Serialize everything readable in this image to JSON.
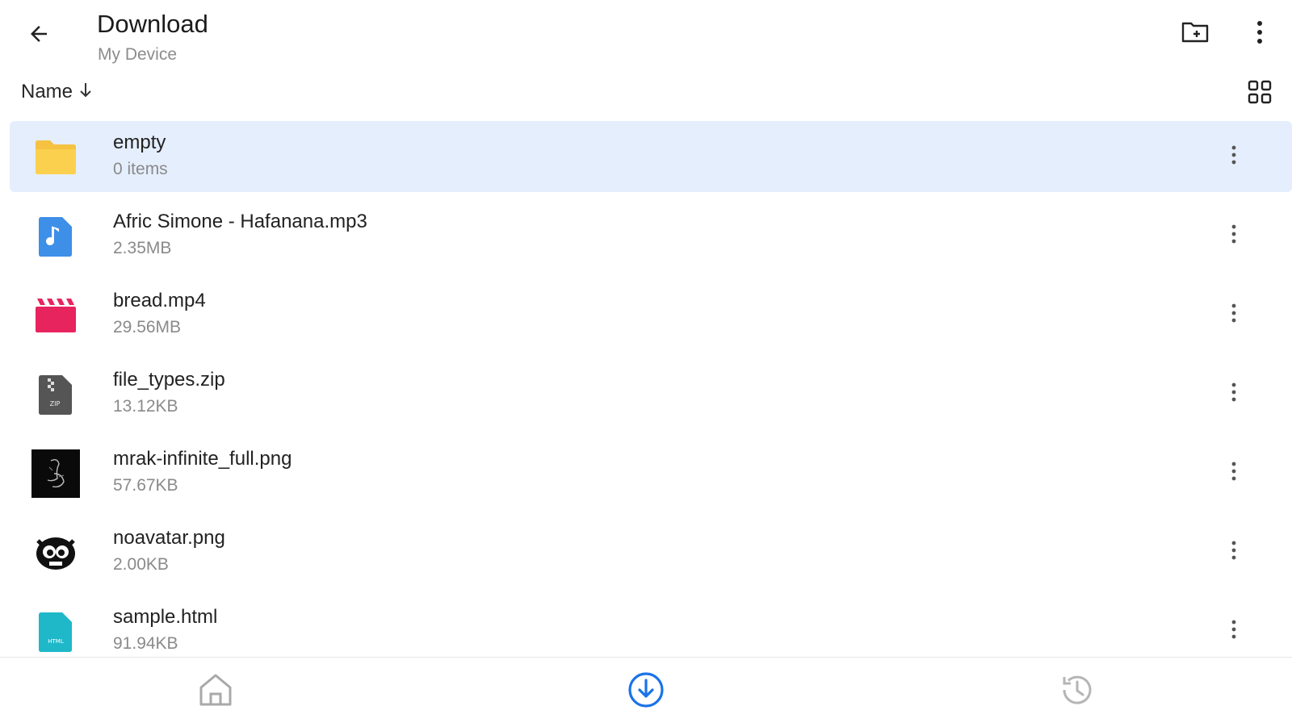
{
  "header": {
    "title": "Download",
    "subtitle": "My Device",
    "back_icon": "arrow-back-icon",
    "new_folder_icon": "create-new-folder-icon",
    "overflow_icon": "more-vert-icon"
  },
  "sort": {
    "label": "Name",
    "direction_icon": "arrow-down-icon",
    "view_toggle_icon": "grid-view-icon"
  },
  "files": [
    {
      "name": "empty",
      "meta": "0 items",
      "icon": "folder-icon",
      "selected": true
    },
    {
      "name": "Afric Simone - Hafanana.mp3",
      "meta": "2.35MB",
      "icon": "audio-file-icon"
    },
    {
      "name": "bread.mp4",
      "meta": "29.56MB",
      "icon": "video-file-icon"
    },
    {
      "name": "file_types.zip",
      "meta": "13.12KB",
      "icon": "zip-file-icon"
    },
    {
      "name": "mrak-infinite_full.png",
      "meta": "57.67KB",
      "icon": "image-thumbnail-icon"
    },
    {
      "name": "noavatar.png",
      "meta": "2.00KB",
      "icon": "image-thumbnail-icon"
    },
    {
      "name": "sample.html",
      "meta": "91.94KB",
      "icon": "html-file-icon"
    }
  ],
  "nav": {
    "home_icon": "home-icon",
    "downloads_icon": "download-circle-icon",
    "recent_icon": "history-icon",
    "active": "downloads"
  },
  "colors": {
    "accent": "#1a73e8",
    "selected_row": "#e5eefc",
    "folder": "#f5c242",
    "audio": "#3d8fe8",
    "video": "#e8245e",
    "zip": "#555555",
    "html": "#1fb8c9"
  }
}
